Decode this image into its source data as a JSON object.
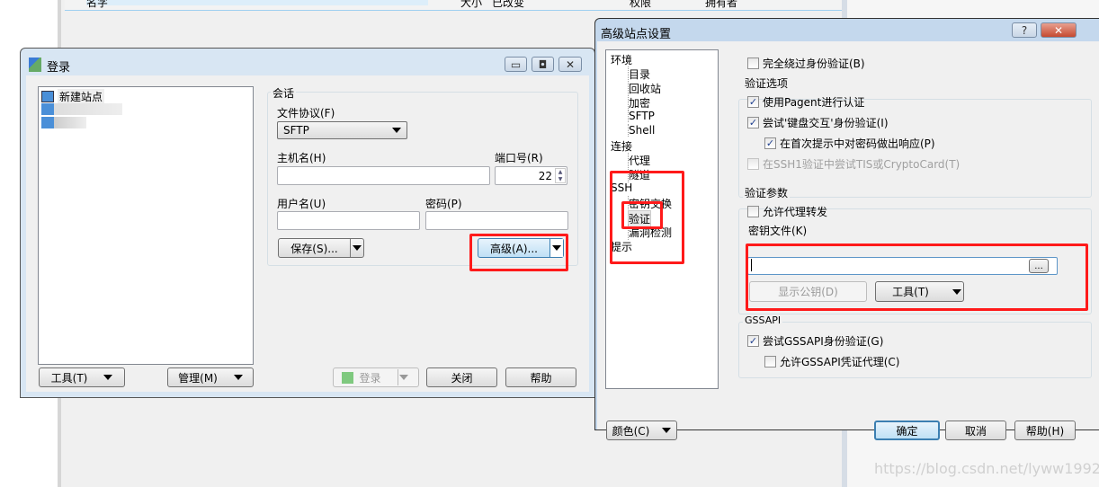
{
  "background": {
    "columns": [
      "名字",
      "大小",
      "已改变",
      "权限",
      "拥有者"
    ],
    "watermark": "https://blog.csdn.net/lyww1992"
  },
  "login": {
    "title": "登录",
    "sites": [
      "新建站点"
    ],
    "session_label": "会话",
    "protocol_label": "文件协议(F)",
    "protocol_value": "SFTP",
    "host_label": "主机名(H)",
    "host_value": "",
    "port_label": "端口号(R)",
    "port_value": "22",
    "user_label": "用户名(U)",
    "user_value": "",
    "password_label": "密码(P)",
    "password_value": "",
    "save_button": "保存(S)...",
    "advanced_button": "高级(A)...",
    "tools_button": "工具(T)",
    "manage_button": "管理(M)",
    "login_button": "登录",
    "close_button": "关闭",
    "help_button": "帮助"
  },
  "advanced": {
    "title": "高级站点设置",
    "help_icon": "?",
    "tree": [
      {
        "label": "环境",
        "level": 0
      },
      {
        "label": "目录",
        "level": 1
      },
      {
        "label": "回收站",
        "level": 1
      },
      {
        "label": "加密",
        "level": 1
      },
      {
        "label": "SFTP",
        "level": 1
      },
      {
        "label": "Shell",
        "level": 1
      },
      {
        "label": "连接",
        "level": 0
      },
      {
        "label": "代理",
        "level": 1
      },
      {
        "label": "隧道",
        "level": 1
      },
      {
        "label": "SSH",
        "level": 0
      },
      {
        "label": "密钥交换",
        "level": 1
      },
      {
        "label": "验证",
        "level": 1,
        "selected": true
      },
      {
        "label": "漏洞检测",
        "level": 1
      },
      {
        "label": "提示",
        "level": 0
      }
    ],
    "bypass_auth": {
      "label": "完全绕过身份验证(B)",
      "checked": false
    },
    "auth_options_label": "验证选项",
    "use_pageant": {
      "label": "使用Pagent进行认证",
      "checked": true
    },
    "keyboard_interactive": {
      "label": "尝试'键盘交互'身份验证(I)",
      "checked": true
    },
    "respond_password": {
      "label": "在首次提示中对密码做出响应(P)",
      "checked": true
    },
    "tis_cryptocard": {
      "label": "在SSH1验证中尝试TIS或CryptoCard(T)",
      "checked": false,
      "disabled": true
    },
    "auth_params_label": "验证参数",
    "agent_forwarding": {
      "label": "允许代理转发",
      "checked": false
    },
    "key_file_label": "密钥文件(K)",
    "key_file_value": "",
    "browse_button": "...",
    "show_pubkey_button": "显示公钥(D)",
    "tools_button": "工具(T)",
    "gssapi_label": "GSSAPI",
    "try_gssapi": {
      "label": "尝试GSSAPI身份验证(G)",
      "checked": true
    },
    "gssapi_delegation": {
      "label": "允许GSSAPI凭证代理(C)",
      "checked": false
    },
    "color_button": "颜色(C)",
    "ok_button": "确定",
    "cancel_button": "取消",
    "help_button": "帮助(H)"
  },
  "colors": {
    "highlight": "#ff1a1a",
    "title_bar": "#c4d8ed"
  }
}
